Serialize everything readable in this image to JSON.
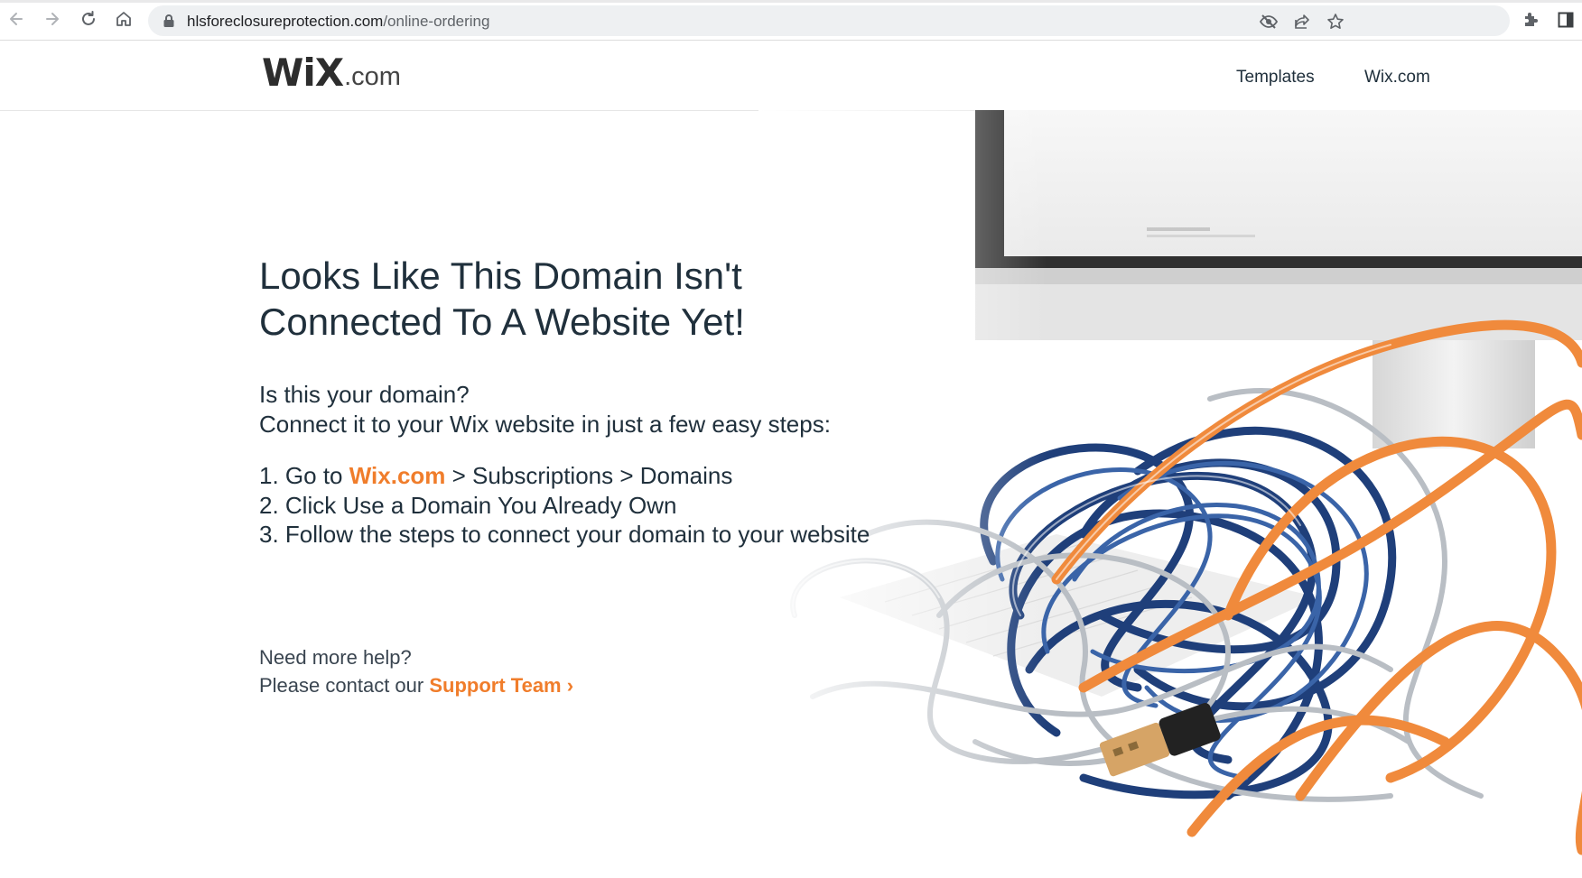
{
  "browser": {
    "url_host": "hlsforeclosureprotection.com",
    "url_path": "/online-ordering"
  },
  "header": {
    "logo_main": "WiX",
    "logo_suffix": ".com",
    "nav": [
      "Templates",
      "Wix.com"
    ]
  },
  "main": {
    "heading_line1": "Looks Like This Domain Isn't",
    "heading_line2": "Connected To A Website Yet!",
    "intro_line1": "Is this your domain?",
    "intro_line2": "Connect it to your Wix website in just a few easy steps:",
    "step1_prefix": "1. Go to ",
    "step1_link": "Wix.com",
    "step1_suffix": " > Subscriptions > Domains",
    "step2": "2. Click Use a Domain You Already Own",
    "step3": "3. Follow the steps to connect your domain to your website"
  },
  "help": {
    "line1": "Need more help?",
    "line2_prefix": "Please contact our ",
    "link": "Support Team",
    "chevron": "›"
  },
  "colors": {
    "accent": "#f07d2b",
    "text": "#20303c"
  }
}
